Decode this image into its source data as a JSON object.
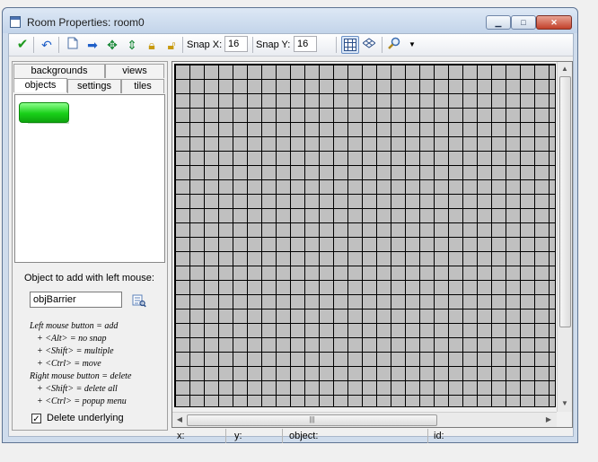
{
  "window": {
    "title": "Room Properties: room0"
  },
  "toolbar": {
    "snap_x_label": "Snap X:",
    "snap_x_value": "16",
    "snap_y_label": "Snap Y:",
    "snap_y_value": "16",
    "icons": [
      "ok-check-icon",
      "undo-icon",
      "clear-room-icon",
      "shift-right-icon",
      "move-all-icon",
      "sort-icon",
      "lock-icon",
      "unlock-icon",
      "grid-icon",
      "isometric-grid-icon",
      "zoom-icon",
      "dropdown-arrow-icon"
    ]
  },
  "tabs": {
    "backgrounds": "backgrounds",
    "views": "views",
    "objects": "objects",
    "settings": "settings",
    "tiles": "tiles"
  },
  "objects_panel": {
    "add_label": "Object to add with left mouse:",
    "selected_object": "objBarrier",
    "help_lines": [
      "Left mouse button = add",
      "+ <Alt> = no snap",
      "+ <Shift> = multiple",
      "+ <Ctrl> = move",
      "Right mouse button = delete",
      "+ <Shift> = delete all",
      "+ <Ctrl> = popup menu"
    ],
    "delete_underlying_label": "Delete underlying",
    "delete_underlying_checked": true
  },
  "status": {
    "x": "x:",
    "y": "y:",
    "object": "object:",
    "id": "id:"
  },
  "colors": {
    "canvas_bg": "#c0c0c0",
    "grid_line": "#000000",
    "object_green": "#18d018"
  }
}
